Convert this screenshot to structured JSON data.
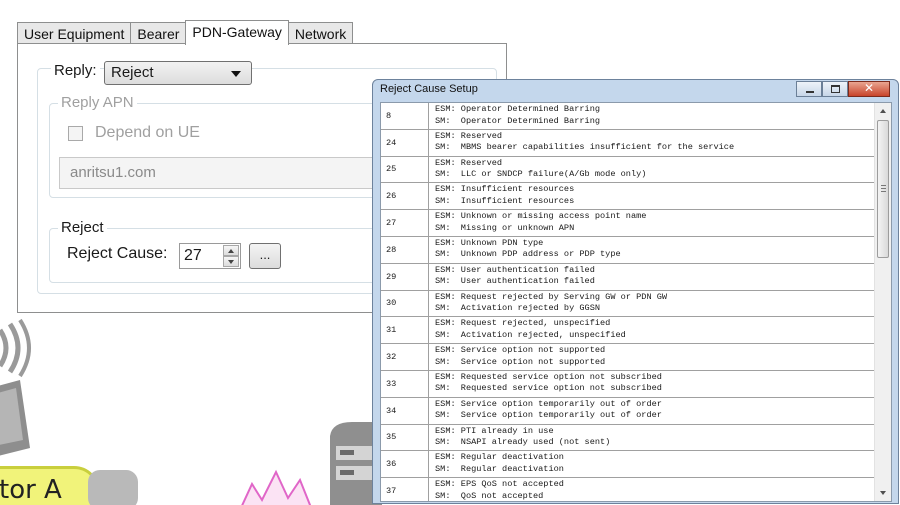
{
  "tabs": [
    {
      "label": "User Equipment",
      "active": false
    },
    {
      "label": "Bearer",
      "active": false
    },
    {
      "label": "PDN-Gateway",
      "active": true
    },
    {
      "label": "Network",
      "active": false
    }
  ],
  "reply": {
    "label": "Reply:",
    "selected": "Reject"
  },
  "reply_apn": {
    "legend": "Reply APN",
    "checkbox_label": "Depend on UE",
    "checked": false,
    "apn_value": "anritsu1.com"
  },
  "reject": {
    "legend": "Reject",
    "cause_label": "Reject Cause:",
    "cause_value": "27",
    "browse_label": "..."
  },
  "dialog": {
    "title": "Reject Cause Setup",
    "causes": [
      {
        "code": "8",
        "esm": "ESM: Operator Determined Barring",
        "sm": "SM:  Operator Determined Barring"
      },
      {
        "code": "24",
        "esm": "ESM: Reserved",
        "sm": "SM:  MBMS bearer capabilities insufficient for the service"
      },
      {
        "code": "25",
        "esm": "ESM: Reserved",
        "sm": "SM:  LLC or SNDCP failure(A/Gb mode only)"
      },
      {
        "code": "26",
        "esm": "ESM: Insufficient resources",
        "sm": "SM:  Insufficient resources"
      },
      {
        "code": "27",
        "esm": "ESM: Unknown or missing access point name",
        "sm": "SM:  Missing or unknown APN"
      },
      {
        "code": "28",
        "esm": "ESM: Unknown PDN type",
        "sm": "SM:  Unknown PDP address or PDP type"
      },
      {
        "code": "29",
        "esm": "ESM: User authentication failed",
        "sm": "SM:  User authentication failed"
      },
      {
        "code": "30",
        "esm": "ESM: Request rejected by Serving GW or PDN GW",
        "sm": "SM:  Activation rejected by GGSN"
      },
      {
        "code": "31",
        "esm": "ESM: Request rejected, unspecified",
        "sm": "SM:  Activation rejected, unspecified"
      },
      {
        "code": "32",
        "esm": "ESM: Service option not supported",
        "sm": "SM:  Service option not supported"
      },
      {
        "code": "33",
        "esm": "ESM: Requested service option not subscribed",
        "sm": "SM:  Requested service option not subscribed"
      },
      {
        "code": "34",
        "esm": "ESM: Service option temporarily out of order",
        "sm": "SM:  Service option temporarily out of order"
      },
      {
        "code": "35",
        "esm": "ESM: PTI already in use",
        "sm": "SM:  NSAPI already used (not sent)"
      },
      {
        "code": "36",
        "esm": "ESM: Regular deactivation",
        "sm": "SM:  Regular deactivation"
      },
      {
        "code": "37",
        "esm": "ESM: EPS QoS not accepted",
        "sm": "SM:  QoS not accepted"
      }
    ]
  },
  "background": {
    "operator_label": "tor A"
  },
  "colors": {
    "title_bar": "#c4d7ec",
    "close_button": "#c8432a",
    "group_border": "#d5dfe5"
  }
}
